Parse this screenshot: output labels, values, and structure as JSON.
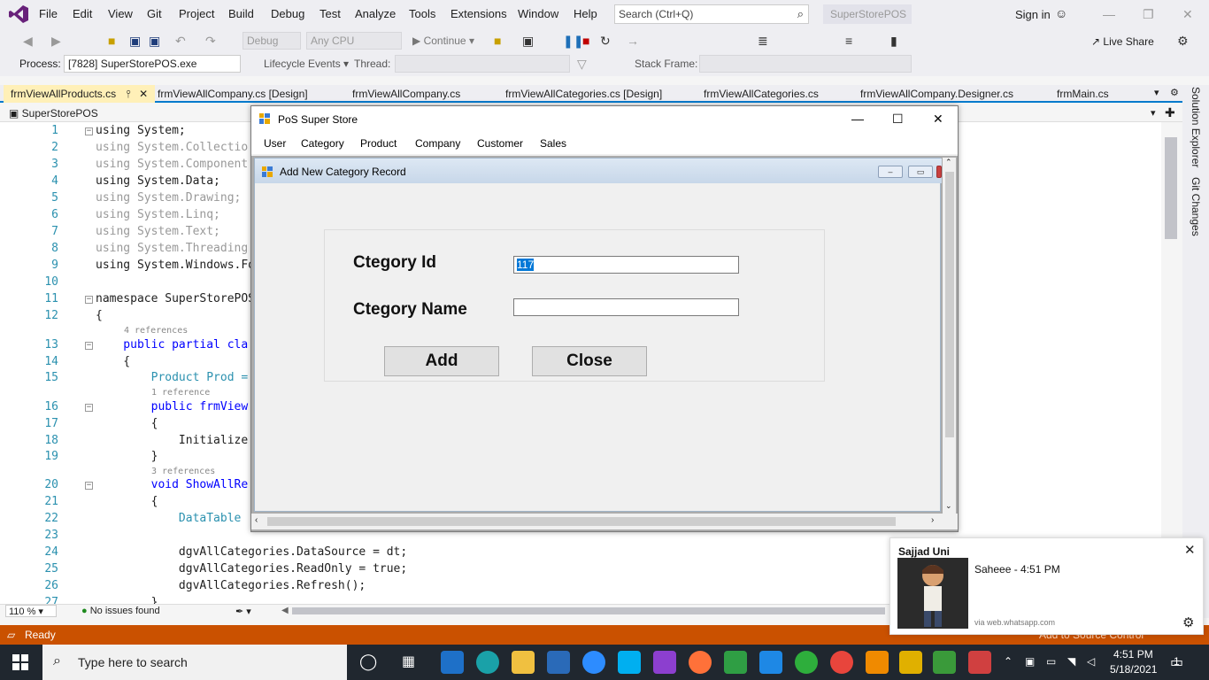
{
  "menu": [
    "File",
    "Edit",
    "View",
    "Git",
    "Project",
    "Build",
    "Debug",
    "Test",
    "Analyze",
    "Tools",
    "Extensions",
    "Window",
    "Help"
  ],
  "search": {
    "placeholder": "Search (Ctrl+Q)"
  },
  "solution_name": "SuperStorePOS",
  "signin": "Sign in",
  "toolbar": {
    "config": "Debug",
    "platform": "Any CPU",
    "continue": "Continue",
    "live_share": "Live Share"
  },
  "debug_bar": {
    "process_label": "Process:",
    "process_value": "[7828] SuperStorePOS.exe",
    "lifecycle": "Lifecycle Events",
    "thread_label": "Thread:",
    "stackframe_label": "Stack Frame:"
  },
  "tabs": [
    {
      "label": "frmViewAllProducts.cs",
      "active": true
    },
    {
      "label": "frmViewAllCompany.cs [Design]"
    },
    {
      "label": "frmViewAllCompany.cs"
    },
    {
      "label": "frmViewAllCategories.cs [Design]"
    },
    {
      "label": "frmViewAllCategories.cs"
    },
    {
      "label": "frmViewAllCompany.Designer.cs"
    },
    {
      "label": "frmMain.cs"
    }
  ],
  "editor_nav": "SuperStorePOS",
  "code": {
    "lines": [
      "1",
      "2",
      "3",
      "4",
      "5",
      "6",
      "7",
      "8",
      "9",
      "10",
      "11",
      "12",
      "13",
      "14",
      "15",
      "16",
      "17",
      "18",
      "19",
      "20",
      "21",
      "22",
      "23",
      "24",
      "25",
      "26",
      "27"
    ],
    "l1": "using System;",
    "l2": "using System.Collectio",
    "l3": "using System.Component",
    "l4": "using System.Data;",
    "l5": "using System.Drawing;",
    "l6": "using System.Linq;",
    "l7": "using System.Text;",
    "l8": "using System.Threading",
    "l9": "using System.Windows.Fo",
    "l11": "namespace SuperStorePOS",
    "l12": "{",
    "ref13": "4 references",
    "l13": "    public partial cla",
    "l14": "    {",
    "l15": "        Product Prod =",
    "ref16": "1 reference",
    "l16": "        public frmView",
    "l17": "        {",
    "l18": "            Initialize",
    "l19": "        }",
    "ref20": "3 references",
    "l20": "        void ShowAllRe",
    "l21": "        {",
    "l22": "            DataTable",
    "l24": "            dgvAllCategories.DataSource = dt;",
    "l25": "            dgvAllCategories.ReadOnly = true;",
    "l26": "            dgvAllCategories.Refresh();",
    "l27": "        }"
  },
  "editor_status": {
    "zoom": "110 %",
    "issues": "No issues found"
  },
  "sidebar": {
    "solution_explorer": "Solution Explorer",
    "git_changes": "Git Changes"
  },
  "statusbar": {
    "ready": "Ready",
    "source_control": "Add to Source Control"
  },
  "pos": {
    "title": "PoS Super Store",
    "menus": [
      "User",
      "Category",
      "Product",
      "Company",
      "Customer",
      "Sales"
    ],
    "child_title": "Add New Category Record",
    "id_label": "Ctegory Id",
    "id_value": "117",
    "name_label": "Ctegory Name",
    "name_value": "",
    "add_button": "Add",
    "close_button": "Close"
  },
  "toast": {
    "name": "Sajjad Uni",
    "message": "Saheee - 4:51 PM",
    "via": "via web.whatsapp.com"
  },
  "taskbar": {
    "search_placeholder": "Type here to search",
    "time": "4:51 PM",
    "date": "5/18/2021",
    "notifications": "1"
  },
  "colors": {
    "accent": "#007acc",
    "statusbar": "#ca5100",
    "keyword": "#0000ff",
    "type": "#2b91af"
  }
}
